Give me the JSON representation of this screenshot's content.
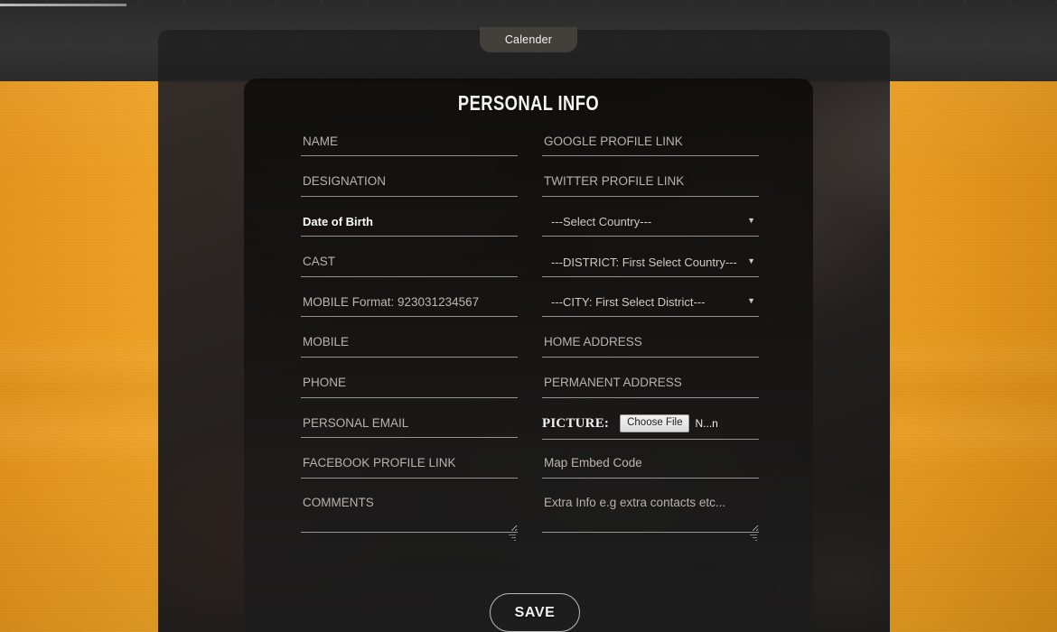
{
  "header": {
    "ghost_text": "",
    "tab_label": "Calender"
  },
  "card": {
    "title": "PERSONAL INFO"
  },
  "form": {
    "left_column": [
      {
        "name": "name",
        "placeholder": "NAME",
        "type": "text"
      },
      {
        "name": "designation",
        "placeholder": "DESIGNATION",
        "type": "text"
      },
      {
        "name": "date-of-birth",
        "placeholder": "Date of Birth",
        "type": "text"
      },
      {
        "name": "cast",
        "placeholder": "CAST",
        "type": "text"
      },
      {
        "name": "mobile-format",
        "placeholder": "MOBILE Format: 923031234567",
        "type": "text"
      },
      {
        "name": "mobile",
        "placeholder": "MOBILE",
        "type": "text"
      },
      {
        "name": "phone",
        "placeholder": "PHONE",
        "type": "text"
      },
      {
        "name": "personal-email",
        "placeholder": "PERSONAL EMAIL",
        "type": "text"
      },
      {
        "name": "facebook-profile",
        "placeholder": "FACEBOOK PROFILE LINK",
        "type": "text"
      },
      {
        "name": "comments",
        "placeholder": "COMMENTS",
        "type": "textarea"
      }
    ],
    "right_column": [
      {
        "name": "google-profile",
        "placeholder": "GOOGLE PROFILE LINK",
        "type": "text"
      },
      {
        "name": "twitter-profile",
        "placeholder": "TWITTER PROFILE LINK",
        "type": "text"
      },
      {
        "name": "country",
        "placeholder": "---Select Country---",
        "type": "select"
      },
      {
        "name": "district",
        "placeholder": "---DISTRICT: First Select Country---",
        "type": "select"
      },
      {
        "name": "city",
        "placeholder": "---CITY: First Select District---",
        "type": "select"
      },
      {
        "name": "home-address",
        "placeholder": "HOME ADDRESS",
        "type": "text"
      },
      {
        "name": "permanent-address",
        "placeholder": "PERMANENT ADDRESS",
        "type": "text"
      },
      {
        "name": "picture",
        "placeholder": "PICTURE:",
        "type": "file"
      },
      {
        "name": "map-embed-code",
        "placeholder": "Map Embed Code",
        "type": "text"
      },
      {
        "name": "extra-info",
        "placeholder": "Extra Info e.g extra contacts etc...",
        "type": "textarea"
      }
    ],
    "picture": {
      "label": "PICTURE:",
      "choose_label": "Choose File",
      "file_name": "N...n"
    },
    "selects": {
      "country_selected": "---Select Country---",
      "district_selected": "---DISTRICT: First Select Country---",
      "city_selected": "---CITY: First Select District---",
      "arrow_glyph": "▼"
    }
  },
  "actions": {
    "save_label": "SAVE"
  },
  "colors": {
    "background_orange": "#f0a524",
    "header_dark": "#2e2e2e",
    "card_dark": "#141211",
    "text_light": "#e9e9e9",
    "placeholder": "#b8b3ad",
    "accent_white": "#ffffff"
  }
}
